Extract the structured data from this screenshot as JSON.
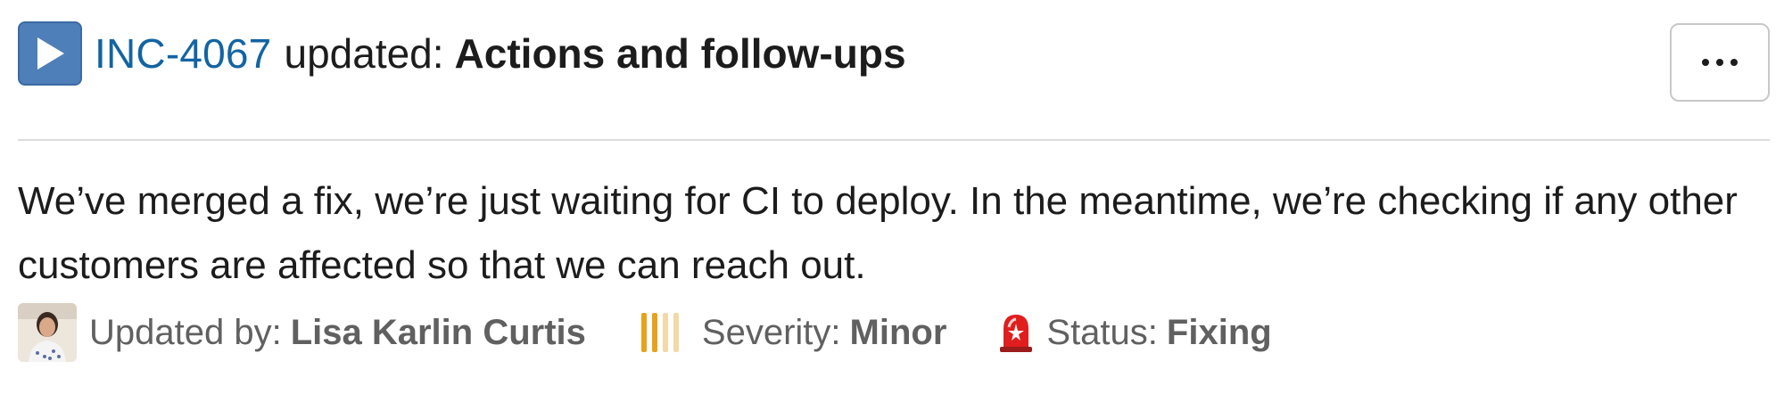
{
  "header": {
    "incident_id": "INC-4067",
    "updated_text": "updated:",
    "section_title": "Actions and follow-ups",
    "icon": "play-button-icon"
  },
  "more_button": {
    "icon": "ellipsis-icon"
  },
  "message": {
    "text": "We’ve merged a fix, we’re just waiting for CI to deploy. In the meantime, we’re checking if any other customers are affected so that we can reach out."
  },
  "meta": {
    "updated_by_label": "Updated by:",
    "updated_by_value": "Lisa Karlin Curtis",
    "severity_label": "Severity:",
    "severity_value": "Minor",
    "status_label": "Status:",
    "status_value": "Fixing",
    "icons": [
      "avatar",
      "severity-bars-icon",
      "siren-icon"
    ]
  },
  "colors": {
    "link": "#1264a3",
    "text": "#1d1c1d",
    "muted": "#616061",
    "severity_active": "#e8a21a",
    "severity_inactive": "#f3d9a8",
    "siren": "#e01e1e"
  }
}
